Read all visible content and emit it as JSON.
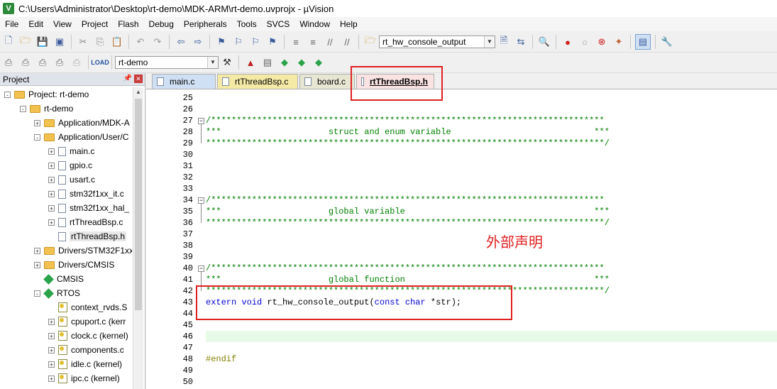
{
  "window": {
    "title": "C:\\Users\\Administrator\\Desktop\\rt-demo\\MDK-ARM\\rt-demo.uvprojx - µVision",
    "app_icon": "V"
  },
  "menu": [
    "File",
    "Edit",
    "View",
    "Project",
    "Flash",
    "Debug",
    "Peripherals",
    "Tools",
    "SVCS",
    "Window",
    "Help"
  ],
  "toolbar": {
    "find_combo_value": "rt_hw_console_output",
    "target_combo_value": "rt-demo"
  },
  "project_pane": {
    "title": "Project",
    "tree": [
      {
        "label": "Project: rt-demo",
        "kind": "project",
        "depth": 0,
        "expander": "-"
      },
      {
        "label": "rt-demo",
        "kind": "folder",
        "depth": 1,
        "expander": "-"
      },
      {
        "label": "Application/MDK-A",
        "kind": "folder",
        "depth": 2,
        "expander": "+"
      },
      {
        "label": "Application/User/C",
        "kind": "folder",
        "depth": 2,
        "expander": "-"
      },
      {
        "label": "main.c",
        "kind": "file",
        "depth": 3,
        "expander": "+"
      },
      {
        "label": "gpio.c",
        "kind": "file",
        "depth": 3,
        "expander": "+"
      },
      {
        "label": "usart.c",
        "kind": "file",
        "depth": 3,
        "expander": "+"
      },
      {
        "label": "stm32f1xx_it.c",
        "kind": "file",
        "depth": 3,
        "expander": "+"
      },
      {
        "label": "stm32f1xx_hal_",
        "kind": "file",
        "depth": 3,
        "expander": "+"
      },
      {
        "label": "rtThreadBsp.c",
        "kind": "file",
        "depth": 3,
        "expander": "+"
      },
      {
        "label": "rtThreadBsp.h",
        "kind": "file",
        "depth": 3,
        "expander": "",
        "selected": true
      },
      {
        "label": "Drivers/STM32F1xx",
        "kind": "folder",
        "depth": 2,
        "expander": "+"
      },
      {
        "label": "Drivers/CMSIS",
        "kind": "folder",
        "depth": 2,
        "expander": "+"
      },
      {
        "label": "CMSIS",
        "kind": "component",
        "depth": 2,
        "expander": ""
      },
      {
        "label": "RTOS",
        "kind": "component",
        "depth": 2,
        "expander": "-"
      },
      {
        "label": "context_rvds.S",
        "kind": "kfile",
        "depth": 3,
        "expander": ""
      },
      {
        "label": "cpuport.c (kerr",
        "kind": "kfile",
        "depth": 3,
        "expander": "+"
      },
      {
        "label": "clock.c (kernel)",
        "kind": "kfile",
        "depth": 3,
        "expander": "+"
      },
      {
        "label": "components.c",
        "kind": "kfile",
        "depth": 3,
        "expander": "+"
      },
      {
        "label": "idle.c (kernel)",
        "kind": "kfile",
        "depth": 3,
        "expander": "+"
      },
      {
        "label": "ipc.c (kernel)",
        "kind": "kfile",
        "depth": 3,
        "expander": "+"
      }
    ]
  },
  "tabs": [
    {
      "label": "main.c",
      "style": "blue"
    },
    {
      "label": "rtThreadBsp.c",
      "style": "yellow"
    },
    {
      "label": "board.c",
      "style": "grey"
    },
    {
      "label": "rtThreadBsp.h",
      "style": "active"
    }
  ],
  "code": {
    "first_line": 25,
    "lines": [
      {
        "n": "25",
        "parts": []
      },
      {
        "n": "26",
        "parts": []
      },
      {
        "n": "27",
        "parts": [
          {
            "t": "/*****************************************************************************",
            "c": "cmt"
          }
        ]
      },
      {
        "n": "28",
        "parts": [
          {
            "t": "***                     struct and enum variable                            ***",
            "c": "cmt"
          }
        ]
      },
      {
        "n": "29",
        "parts": [
          {
            "t": "******************************************************************************/",
            "c": "cmt"
          }
        ]
      },
      {
        "n": "30",
        "parts": []
      },
      {
        "n": "31",
        "parts": []
      },
      {
        "n": "32",
        "parts": []
      },
      {
        "n": "33",
        "parts": []
      },
      {
        "n": "34",
        "parts": [
          {
            "t": "/*****************************************************************************",
            "c": "cmt"
          }
        ]
      },
      {
        "n": "35",
        "parts": [
          {
            "t": "***                     global variable                                     ***",
            "c": "cmt"
          }
        ]
      },
      {
        "n": "36",
        "parts": [
          {
            "t": "******************************************************************************/",
            "c": "cmt"
          }
        ]
      },
      {
        "n": "37",
        "parts": []
      },
      {
        "n": "38",
        "parts": []
      },
      {
        "n": "39",
        "parts": []
      },
      {
        "n": "40",
        "parts": [
          {
            "t": "/*****************************************************************************",
            "c": "cmt"
          }
        ]
      },
      {
        "n": "41",
        "parts": [
          {
            "t": "***                     global function                                     ***",
            "c": "cmt"
          }
        ]
      },
      {
        "n": "42",
        "parts": [
          {
            "t": "******************************************************************************/",
            "c": "cmt"
          }
        ]
      },
      {
        "n": "43",
        "parts": [
          {
            "t": "extern",
            "c": "kw"
          },
          {
            "t": " ",
            "c": ""
          },
          {
            "t": "void",
            "c": "kw"
          },
          {
            "t": " rt_hw_console_output(",
            "c": ""
          },
          {
            "t": "const",
            "c": "kw"
          },
          {
            "t": " ",
            "c": ""
          },
          {
            "t": "char",
            "c": "kw"
          },
          {
            "t": " *str);",
            "c": ""
          }
        ]
      },
      {
        "n": "44",
        "parts": []
      },
      {
        "n": "45",
        "parts": []
      },
      {
        "n": "46",
        "parts": [],
        "highlight": true
      },
      {
        "n": "47",
        "parts": []
      },
      {
        "n": "48",
        "parts": [
          {
            "t": "#endif",
            "c": "pp"
          }
        ]
      },
      {
        "n": "49",
        "parts": []
      },
      {
        "n": "50",
        "parts": []
      }
    ]
  },
  "annotation": {
    "note": "外部声明",
    "color": "#e02020"
  },
  "colors": {
    "comment": "#008000",
    "keyword": "#0000d0",
    "preprocessor": "#808000",
    "current_line": "#e8fbe8"
  }
}
